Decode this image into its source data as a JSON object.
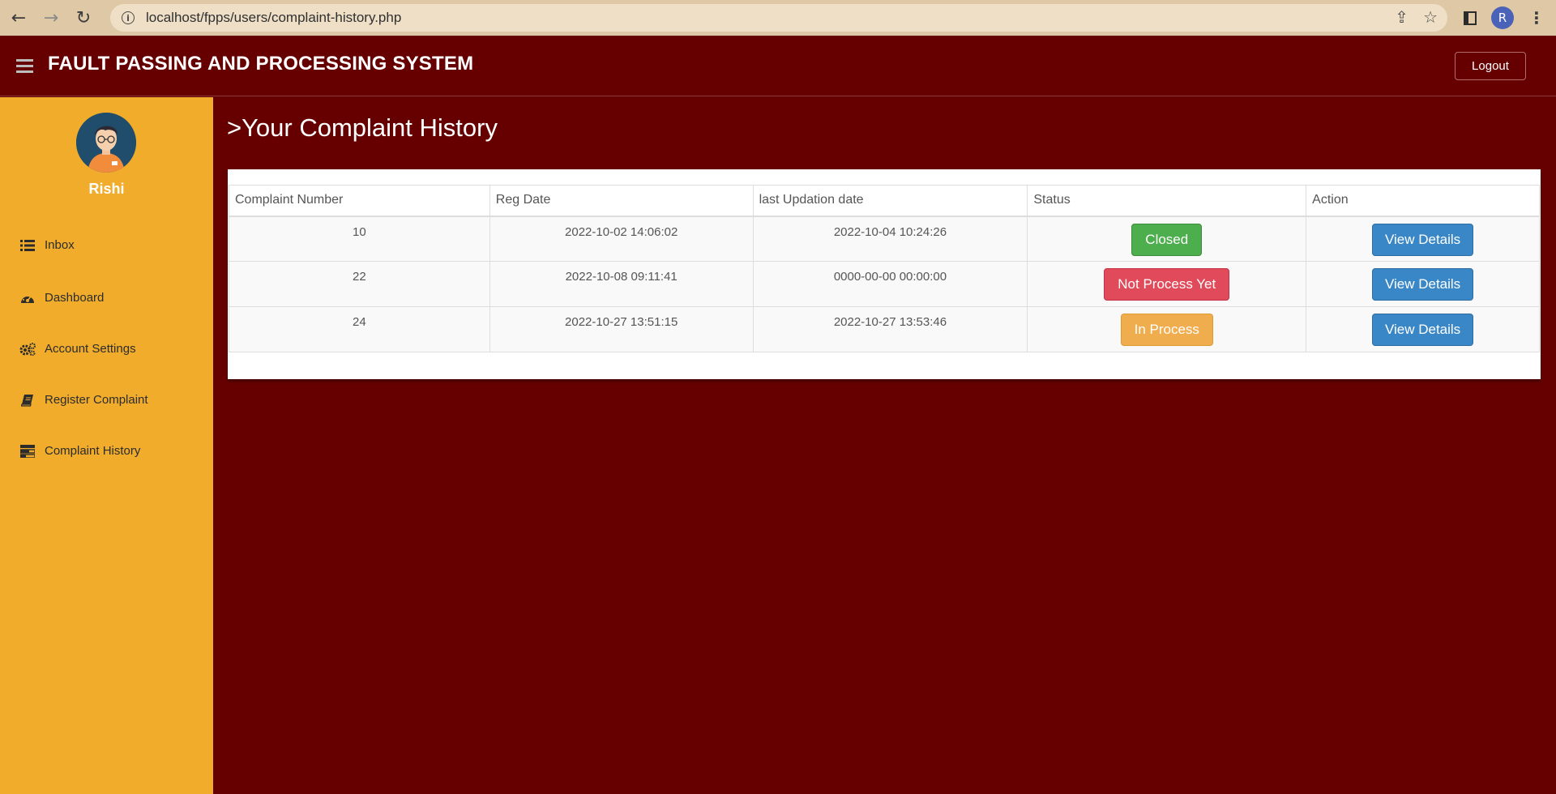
{
  "browser": {
    "url": "localhost/fpps/users/complaint-history.php",
    "profile_initial": "R"
  },
  "header": {
    "brand": "FAULT PASSING AND PROCESSING SYSTEM",
    "logout_label": "Logout",
    "background_color": "#660000"
  },
  "sidebar": {
    "username": "Rishi",
    "background_color": "#f0ac2a",
    "items": [
      {
        "label": "Inbox",
        "icon": "list-icon"
      },
      {
        "label": "Dashboard",
        "icon": "dashboard-icon"
      },
      {
        "label": "Account Settings",
        "icon": "cogs-icon"
      },
      {
        "label": "Register Complaint",
        "icon": "book-icon"
      },
      {
        "label": "Complaint History",
        "icon": "tasks-icon"
      }
    ]
  },
  "main": {
    "title": ">Your Complaint History",
    "table": {
      "columns": [
        "Complaint Number",
        "Reg Date",
        "last Updation date",
        "Status",
        "Action"
      ],
      "rows": [
        {
          "number": "10",
          "reg_date": "2022-10-02 14:06:02",
          "updated": "2022-10-04 10:24:26",
          "status": "Closed",
          "status_color": "#4cae4c",
          "action": "View Details"
        },
        {
          "number": "22",
          "reg_date": "2022-10-08 09:11:41",
          "updated": "0000-00-00 00:00:00",
          "status": "Not Process Yet",
          "status_color": "#e04a5a",
          "action": "View Details"
        },
        {
          "number": "24",
          "reg_date": "2022-10-27 13:51:15",
          "updated": "2022-10-27 13:53:46",
          "status": "In Process",
          "status_color": "#f0ad4e",
          "action": "View Details"
        }
      ]
    }
  }
}
